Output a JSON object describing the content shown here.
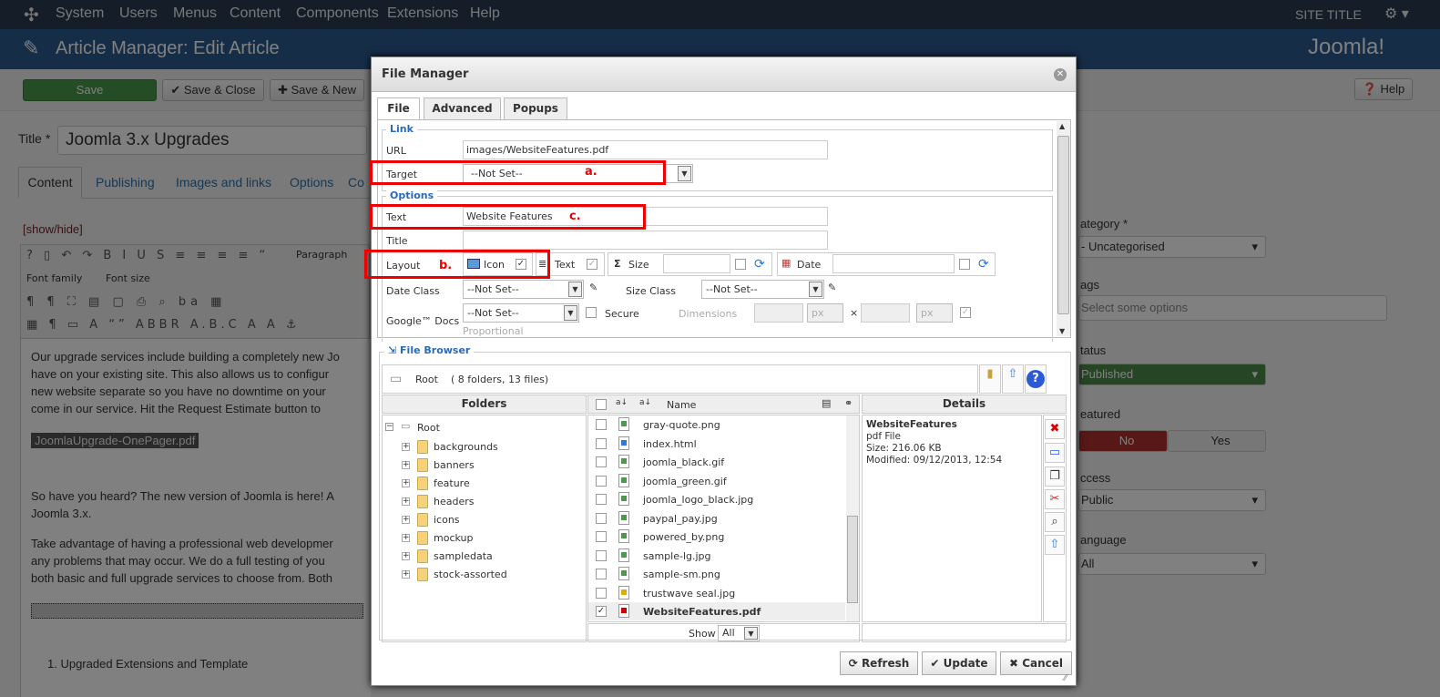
{
  "nav": {
    "items": [
      "System",
      "Users",
      "Menus",
      "Content",
      "Components",
      "Extensions",
      "Help"
    ],
    "site_title": "SITE TITLE",
    "gear_icon": "gear-icon"
  },
  "header": {
    "title": "Article Manager: Edit Article",
    "logo": "Joomla!"
  },
  "toolbar": {
    "save": "Save",
    "save_close": "Save & Close",
    "save_new": "Save & New",
    "help": "Help"
  },
  "article": {
    "title_label": "Title *",
    "title_value": "Joomla 3.x Upgrades",
    "tabs": [
      "Content",
      "Publishing",
      "Images and links",
      "Options",
      "Co"
    ],
    "show_hide": "[show/hide]",
    "editor": {
      "format": "Paragraph",
      "font_family": "Font family",
      "font_size": "Font size"
    },
    "body": [
      "Our upgrade services include building a completely new Jo",
      "have on your existing site.  This also allows us to configur",
      "new website separate so you have no downtime on your",
      "come in our service.  Hit the Request Estimate button to"
    ],
    "link": "JoomlaUpgrade-OnePager.pdf",
    "body2": [
      "So have you heard? The new version of Joomla is here! A",
      "Joomla 3.x."
    ],
    "body3": [
      "Take advantage of having a professional web developmer",
      "any problems that may occur. We do a full testing of you",
      "both basic and full upgrade services to choose from. Both"
    ],
    "list_item": "1.  Upgraded Extensions and Template"
  },
  "sidebar": {
    "category_label": "ategory *",
    "category": "- Uncategorised",
    "tags_label": "ags",
    "tags_placeholder": "Select some options",
    "status_label": "tatus",
    "status": "Published",
    "featured_label": "eatured",
    "featured_no": "No",
    "featured_yes": "Yes",
    "access_label": "ccess",
    "access": "Public",
    "language_label": "anguage",
    "language": "All"
  },
  "modal": {
    "title": "File Manager",
    "tabs": [
      "File",
      "Advanced",
      "Popups"
    ],
    "link_legend": "Link",
    "url_label": "URL",
    "url_value": "images/WebsiteFeatures.pdf",
    "target_label": "Target",
    "target_value": "--Not Set--",
    "options_legend": "Options",
    "text_label": "Text",
    "text_value": "Website Features",
    "title_label": "Title",
    "title_value": "",
    "layout_label": "Layout",
    "layout_icon": "Icon",
    "layout_text": "Text",
    "layout_size": "Size",
    "layout_date": "Date",
    "date_class_label": "Date Class",
    "date_class": "--Not Set--",
    "size_class_label": "Size Class",
    "size_class": "--Not Set--",
    "google_docs_label": "Google™ Docs",
    "google_docs": "--Not Set--",
    "secure_label": "Secure",
    "dimensions_label": "Dimensions",
    "px": "px",
    "times": "×",
    "proportional": "Proportional",
    "annotations": {
      "a": "a.",
      "b": "b.",
      "c": "c."
    },
    "browser": {
      "legend": "File Browser",
      "root": "Root",
      "root_info": "( 8 folders, 13 files)",
      "folders_header": "Folders",
      "name_header": "Name",
      "details_header": "Details",
      "folders": [
        "backgrounds",
        "banners",
        "feature",
        "headers",
        "icons",
        "mockup",
        "sampledata",
        "stock-assorted"
      ],
      "files": [
        "gray-quote.png",
        "index.html",
        "joomla_black.gif",
        "joomla_green.gif",
        "joomla_logo_black.jpg",
        "paypal_pay.jpg",
        "powered_by.png",
        "sample-lg.jpg",
        "sample-sm.png",
        "trustwave seal.jpg",
        "WebsiteFeatures.pdf"
      ],
      "selected_file": "WebsiteFeatures.pdf",
      "details": {
        "name": "WebsiteFeatures",
        "type": "pdf File",
        "size": "Size: 216.06 KB",
        "modified": "Modified: 09/12/2013, 12:54"
      },
      "show_label": "Show",
      "show_value": "All"
    },
    "buttons": {
      "refresh": "Refresh",
      "update": "Update",
      "cancel": "Cancel"
    }
  },
  "colors": {
    "annotation": "#e00000",
    "legend": "#2a6ab8",
    "save_green": "#4a9a4a",
    "status_green": "#4a8a4a",
    "featured_red": "#b03030"
  }
}
